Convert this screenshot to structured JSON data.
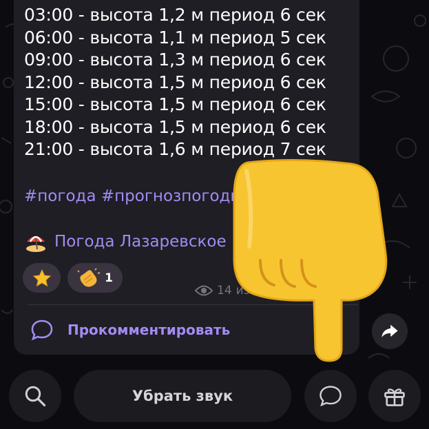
{
  "forecast": [
    "03:00 - высота 1,2 м период 6 сек",
    "06:00 - высота 1,1 м период 5 сек",
    "09:00 - высота 1,3 м период 6 сек",
    "12:00 - высота 1,5 м период 6 сек",
    "15:00 - высота 1,5 м период 6 сек",
    "18:00 - высота 1,5 м период 6 сек",
    "21:00 - высота 1,6 м период 7 сек"
  ],
  "post": {
    "hashtags": "#погода #прогнозпогоды",
    "channel_name": "Погода Лазаревское",
    "views": "14",
    "edited_label": "изм."
  },
  "reactions": [
    {
      "icon": "star-icon",
      "count": ""
    },
    {
      "icon": "clapping-hands-icon",
      "count": "1"
    }
  ],
  "comment_label": "Прокомментировать",
  "bottom_bar": {
    "mute_label": "Убрать звук"
  },
  "colors": {
    "background": "#0c0c10",
    "bubble": "#1e1e24",
    "accent": "#a38bf3",
    "muted": "#75767c"
  }
}
